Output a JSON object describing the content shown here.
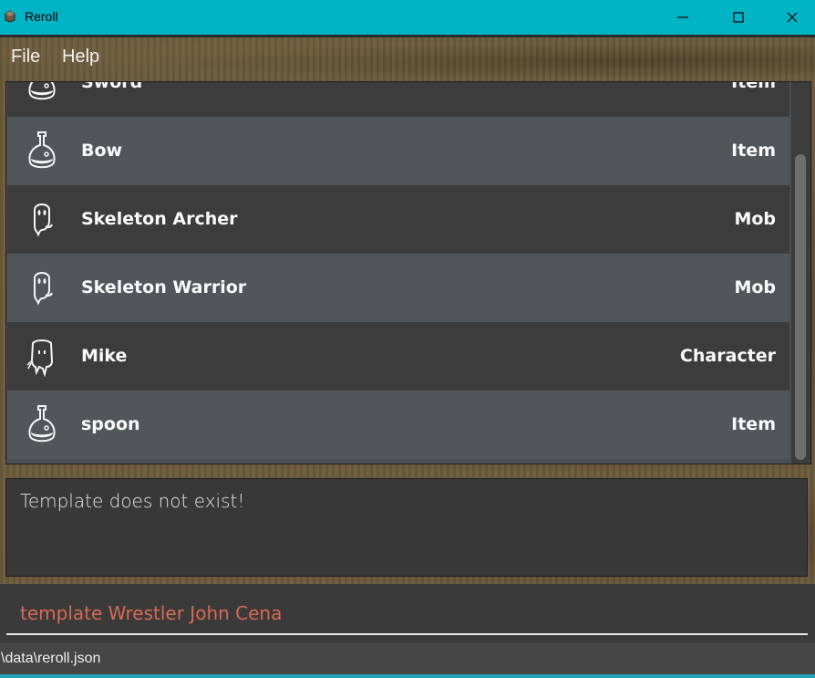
{
  "window": {
    "title": "Reroll",
    "accent": "#00b4c5"
  },
  "menu": {
    "items": [
      "File",
      "Help"
    ]
  },
  "list": {
    "rows": [
      {
        "name": "Sword",
        "type": "Item",
        "icon": "potion-icon"
      },
      {
        "name": "Bow",
        "type": "Item",
        "icon": "potion-icon"
      },
      {
        "name": "Skeleton Archer",
        "type": "Mob",
        "icon": "ghost-icon"
      },
      {
        "name": "Skeleton Warrior",
        "type": "Mob",
        "icon": "ghost-icon"
      },
      {
        "name": "Mike",
        "type": "Character",
        "icon": "character-icon"
      },
      {
        "name": "spoon",
        "type": "Item",
        "icon": "potion-icon"
      }
    ]
  },
  "result": {
    "message": "Template does not exist!"
  },
  "command": {
    "value": "template Wrestler John Cena",
    "error_color": "#d96a55"
  },
  "status": {
    "path": "\\data\\reroll.json"
  }
}
